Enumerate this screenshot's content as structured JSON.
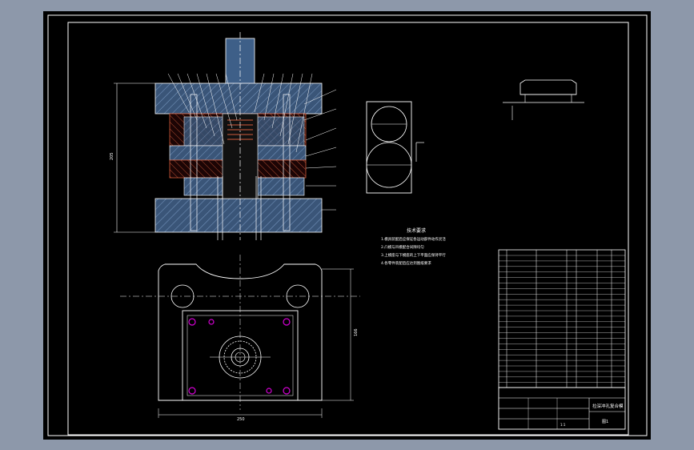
{
  "drawing": {
    "note_title": "技术要求",
    "note_lines": [
      "1.模具装配后应保证各运动部件动作灵活",
      "2.凸模与凹模配合间隙均匀",
      "3.上模座与下模座的上下平面应保持平行",
      "4.各零件装配后应达到图纸要求"
    ],
    "dim_overall_height": "205",
    "dim_bottom_width": "250",
    "dim_plan_height": "166",
    "title_block": {
      "title": "拉深冲孔复合模",
      "scale": "1:1",
      "sheet_no": "图1"
    },
    "colors": {
      "background": "#000000",
      "frame": "#ffffff",
      "hatch": "#4d6a8f",
      "red": "#c8553a",
      "accent": "#d400d4"
    }
  }
}
